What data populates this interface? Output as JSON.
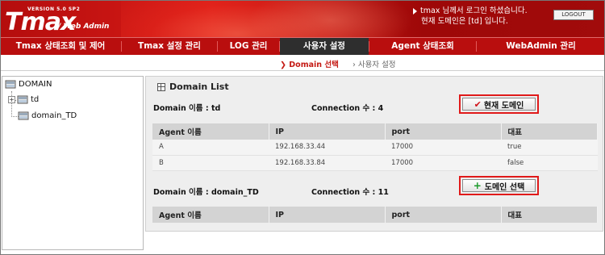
{
  "header": {
    "version": "VERSION 5.0 SP2",
    "logo": "Tmax",
    "logo_sub": "/ Web Admin",
    "login_line1": "tmax 님께서 로그인 하셨습니다.",
    "login_line2": "현재 도메인은 [td] 입니다.",
    "logout": "LOGOUT"
  },
  "nav": [
    {
      "label": "Tmax 상태조회 및 제어"
    },
    {
      "label": "Tmax 설정 관리"
    },
    {
      "label": "LOG 관리"
    },
    {
      "label": "사용자 설정"
    },
    {
      "label": "Agent 상태조회"
    },
    {
      "label": "WebAdmin 관리"
    }
  ],
  "subnav": {
    "active": "Domain 선택",
    "other": "사용자 설정"
  },
  "tree": {
    "root": "DOMAIN",
    "children": [
      {
        "label": "td"
      },
      {
        "label": "domain_TD"
      }
    ]
  },
  "panel": {
    "title": "Domain List",
    "domains": [
      {
        "label": "Domain 이름 : td",
        "connection": "Connection 수 : 4",
        "button": "현재 도메인",
        "headers": [
          "Agent 이름",
          "IP",
          "port",
          "대표"
        ],
        "rows": [
          [
            "A",
            "192.168.33.44",
            "17000",
            "true"
          ],
          [
            "B",
            "192.168.33.84",
            "17000",
            "false"
          ]
        ]
      },
      {
        "label": "Domain 이름 : domain_TD",
        "connection": "Connection 수 : 11",
        "button": "도메인 선택",
        "headers": [
          "Agent 이름",
          "IP",
          "port",
          "대표"
        ],
        "rows": []
      }
    ]
  },
  "colors": {
    "brand": "#b90e0e",
    "active_tab": "#2e2e2e",
    "highlight_box": "#e01a1a"
  },
  "icons": {
    "check": "checkmark-icon",
    "plus": "plus-icon",
    "grid": "grid-icon",
    "tree_node": "database-icon"
  }
}
